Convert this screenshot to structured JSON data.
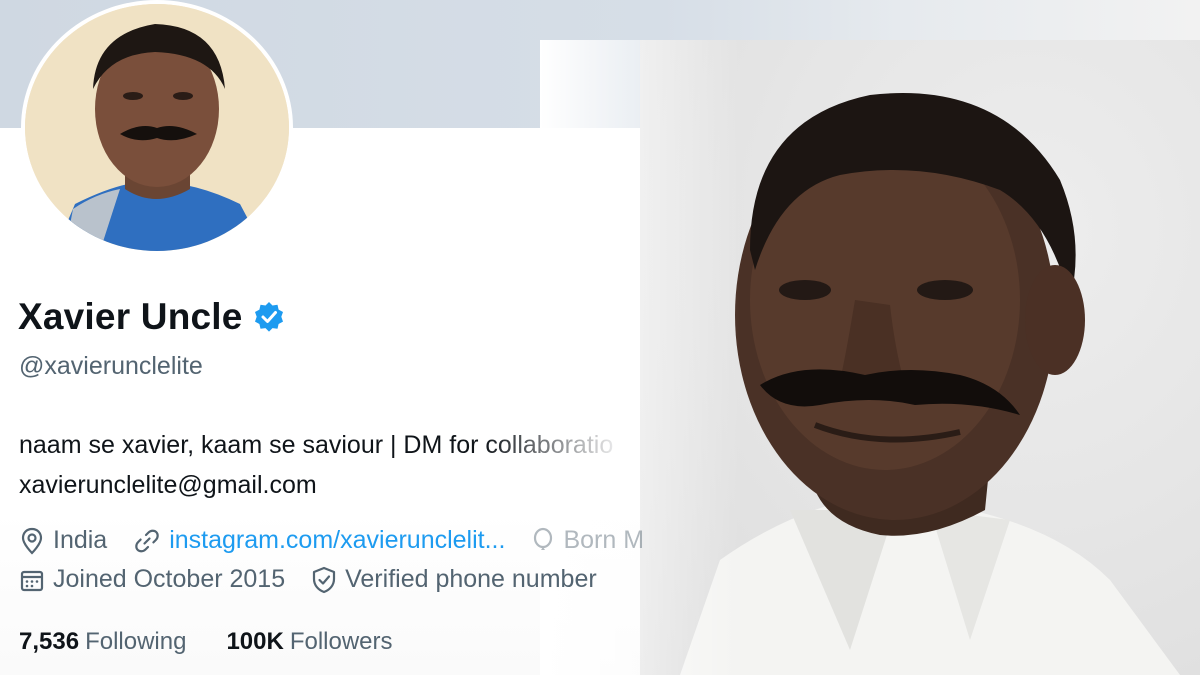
{
  "profile": {
    "display_name": "Xavier Uncle",
    "verified": true,
    "handle": "@xavierunclelite",
    "bio_line1": "naam se xavier, kaam se saviour | DM for collaboratio",
    "bio_line2": "xavierunclelite@gmail.com",
    "location": "India",
    "website": "instagram.com/xavierunclelit...",
    "birth": "Born M",
    "joined": "Joined October 2015",
    "phone_status": "Verified phone number",
    "following_count": "7,536",
    "following_label": "Following",
    "followers_count": "100K",
    "followers_label": "Followers"
  },
  "icons": {
    "verified": "verified-badge-icon",
    "location": "location-pin-icon",
    "link": "link-icon",
    "birth": "balloon-icon",
    "calendar": "calendar-icon",
    "phone_verified": "shield-check-icon"
  },
  "colors": {
    "accent": "#1d9bf0",
    "text_primary": "#0f1419",
    "text_secondary": "#536471",
    "banner": "#d6dee7"
  }
}
